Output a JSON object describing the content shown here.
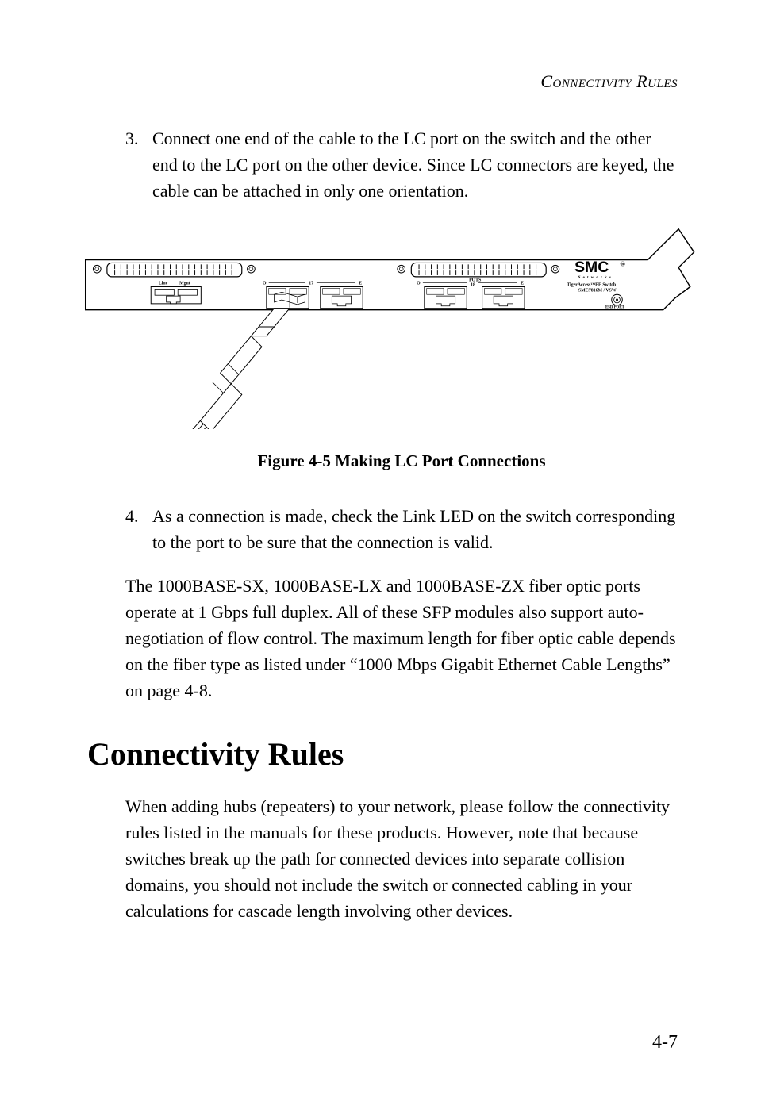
{
  "running_header": "Connectivity Rules",
  "list3": {
    "num": "3.",
    "text": "Connect one end of the cable to the LC port on the switch and the other end to the LC port on the other device. Since LC connectors are keyed, the cable can be attached in only one orientation."
  },
  "figure": {
    "caption": "Figure 4-5  Making LC Port Connections",
    "brand": "SMC",
    "brand_sub": "N e t w o r k s",
    "product_line1": "TigerAccess™EE Switch",
    "product_line2": "SMC7816M / VSW",
    "label_line": "Line",
    "label_mgnt": "Mgnt",
    "label_pots": "POTS",
    "label_o1": "O",
    "label_17": "17",
    "label_e1": "E",
    "label_o2": "O",
    "label_18": "18",
    "label_e2": "E",
    "label_esd": "ESD PORT"
  },
  "list4": {
    "num": "4.",
    "text": "As a connection is made, check the Link LED on the switch corresponding to the port to be sure that the connection is valid."
  },
  "para1": "The 1000BASE-SX, 1000BASE-LX and 1000BASE-ZX fiber optic ports operate at 1 Gbps full duplex. All of these SFP modules also support auto-negotiation of flow control. The maximum length for fiber optic cable depends on the fiber type as listed under “1000 Mbps Gigabit Ethernet Cable Lengths” on page 4-8.",
  "heading": "Connectivity Rules",
  "para2": "When adding hubs (repeaters) to your network, please follow the connectivity rules listed in the manuals for these products. However, note that because switches break up the path for connected devices into separate collision domains, you should not include the switch or connected cabling in your calculations for cascade length involving other devices.",
  "page_number": "4-7"
}
